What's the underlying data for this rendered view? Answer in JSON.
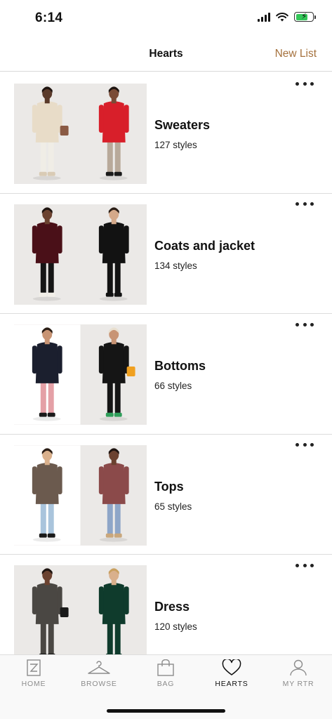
{
  "status": {
    "time": "6:14"
  },
  "header": {
    "title": "Hearts",
    "action": "New List"
  },
  "lists": [
    {
      "name": "Sweaters",
      "count": "127 styles",
      "images": [
        {
          "top": "#e8dcc8",
          "bottom": "#f0ede6",
          "shoes": "#d9cbb5",
          "skin": "#5a3a2a",
          "hair": "#1e1410",
          "bg": "#ebe9e7",
          "bag": "#8a5a44"
        },
        {
          "top": "#d81f2a",
          "bottom": "#b8a99a",
          "shoes": "#1a1a1a",
          "skin": "#7a4b36",
          "hair": "#1e1410",
          "bg": "#ebe9e7",
          "bag": ""
        }
      ]
    },
    {
      "name": "Coats and jacket",
      "count": "134 styles",
      "images": [
        {
          "top": "#4a1018",
          "bottom": "#151515",
          "shoes": "#f2efe8",
          "skin": "#6b4230",
          "hair": "#1e1410",
          "bg": "#ebe9e7",
          "bag": ""
        },
        {
          "top": "#121212",
          "bottom": "#121212",
          "shoes": "#121212",
          "skin": "#d4a98a",
          "hair": "#2a1d15",
          "bg": "#ebe9e7",
          "bag": ""
        }
      ]
    },
    {
      "name": "Bottoms",
      "count": "66 styles",
      "images": [
        {
          "top": "#1b1f2e",
          "bottom": "#e4a0a6",
          "shoes": "#1a1a1a",
          "skin": "#c89474",
          "hair": "#2a1d15",
          "bg": "#ffffff",
          "bag": ""
        },
        {
          "top": "#151515",
          "bottom": "#151515",
          "shoes": "#2f9e5a",
          "skin": "#c89474",
          "hair": "#e9e0d0",
          "bg": "#ebe9e7",
          "bag": "#f0a020"
        }
      ]
    },
    {
      "name": "Tops",
      "count": "65 styles",
      "images": [
        {
          "top": "#6b5a4e",
          "bottom": "#a9c4dc",
          "shoes": "#1a1a1a",
          "skin": "#d9b08c",
          "hair": "#2a1d15",
          "bg": "#ffffff",
          "bag": ""
        },
        {
          "top": "#8b4a4a",
          "bottom": "#8ea6c8",
          "shoes": "#c9a77c",
          "skin": "#6b4230",
          "hair": "#1e1410",
          "bg": "#ebe9e7",
          "bag": ""
        }
      ]
    },
    {
      "name": "Dress",
      "count": "120 styles",
      "images": [
        {
          "top": "#4a4743",
          "bottom": "#4a4743",
          "shoes": "#1a1a1a",
          "skin": "#6b4230",
          "hair": "#1e1410",
          "bg": "#ebe9e7",
          "bag": "#1a1a1a"
        },
        {
          "top": "#0f3b2c",
          "bottom": "#0f3b2c",
          "shoes": "#0f3b2c",
          "skin": "#d9b08c",
          "hair": "#c9a060",
          "bg": "#ebe9e7",
          "bag": ""
        }
      ]
    }
  ],
  "tabs": [
    {
      "label": "HOME",
      "icon": "home-icon"
    },
    {
      "label": "BROWSE",
      "icon": "hanger-icon"
    },
    {
      "label": "BAG",
      "icon": "bag-icon"
    },
    {
      "label": "HEARTS",
      "icon": "heart-icon",
      "active": true
    },
    {
      "label": "MY RTR",
      "icon": "person-icon"
    }
  ],
  "colors": {
    "accent": "#a5713d",
    "active_tab": "#111111",
    "inactive_tab": "#8c8c8c"
  }
}
